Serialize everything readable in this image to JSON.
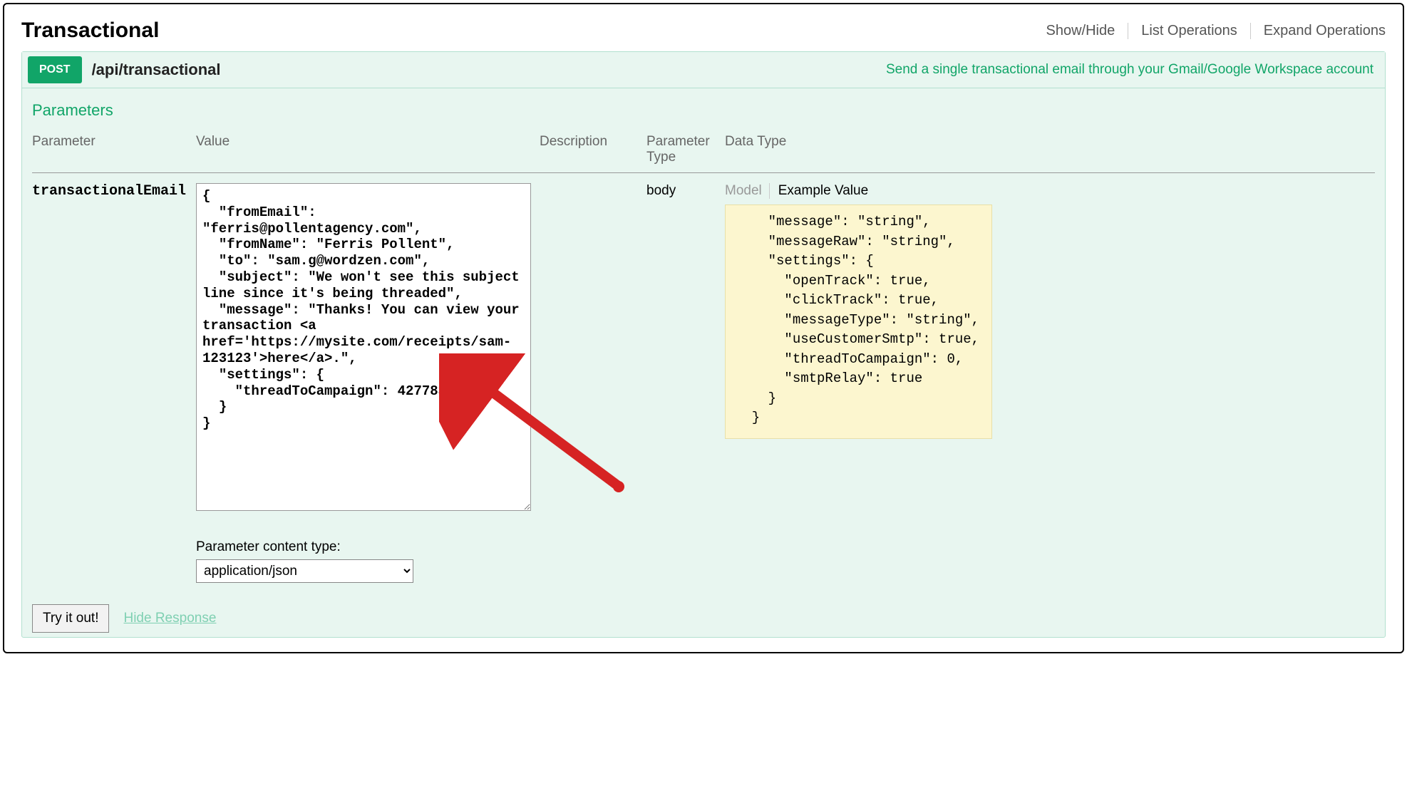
{
  "header": {
    "title": "Transactional",
    "actions": [
      "Show/Hide",
      "List Operations",
      "Expand Operations"
    ]
  },
  "operation": {
    "method": "POST",
    "path": "/api/transactional",
    "summary": "Send a single transactional email through your Gmail/Google Workspace account"
  },
  "sectionTitle": "Parameters",
  "columns": {
    "parameter": "Parameter",
    "value": "Value",
    "description": "Description",
    "paramType": "Parameter Type",
    "dataType": "Data Type"
  },
  "row": {
    "name": "transactionalEmail",
    "valueBody": "{\n  \"fromEmail\": \"ferris@pollentagency.com\",\n  \"fromName\": \"Ferris Pollent\",\n  \"to\": \"sam.g@wordzen.com\",\n  \"subject\": \"We won't see this subject line since it's being threaded\",\n  \"message\": \"Thanks! You can view your transaction <a href='https://mysite.com/receipts/sam-123123'>here</a>.\",\n  \"settings\": {\n    \"threadToCampaign\": 42778373\n  }\n}",
    "paramType": "body",
    "tabs": {
      "model": "Model",
      "example": "Example Value"
    },
    "exampleSnippet": "    \"message\": \"string\",\n    \"messageRaw\": \"string\",\n    \"settings\": {\n      \"openTrack\": true,\n      \"clickTrack\": true,\n      \"messageType\": \"string\",\n      \"useCustomerSmtp\": true,\n      \"threadToCampaign\": 0,\n      \"smtpRelay\": true\n    }\n  }"
  },
  "contentType": {
    "label": "Parameter content type:",
    "selected": "application/json"
  },
  "footer": {
    "tryButton": "Try it out!",
    "hideResponse": "Hide Response"
  }
}
